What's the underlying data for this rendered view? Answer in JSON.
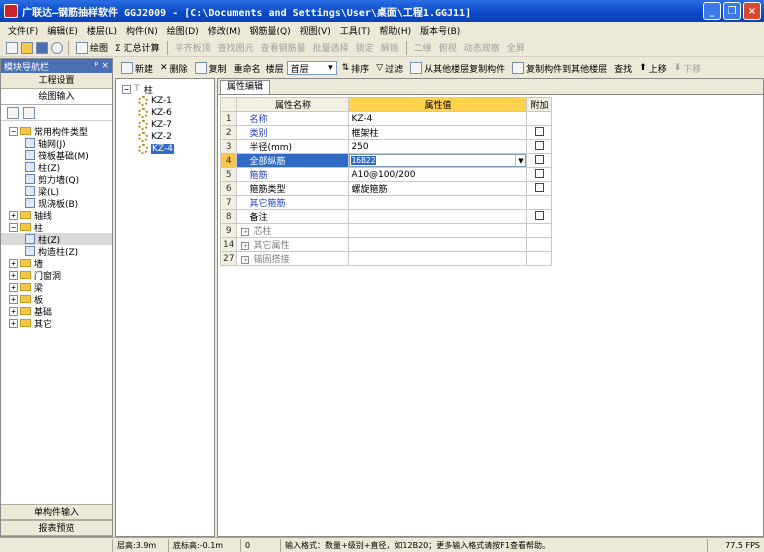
{
  "window": {
    "title": "广联达—钢筋抽样软件 GGJ2009 - [C:\\Documents and Settings\\User\\桌面\\工程1.GGJ11]",
    "buttons": [
      "_",
      "❐",
      "×"
    ]
  },
  "menu": [
    "文件(F)",
    "编辑(E)",
    "楼层(L)",
    "构件(N)",
    "绘图(D)",
    "修改(M)",
    "钢筋量(Q)",
    "视图(V)",
    "工具(T)",
    "帮助(H)",
    "版本号(B)"
  ],
  "toolbar": {
    "draw": "绘图",
    "sum": "Σ 汇总计算",
    "flat_top": "平齐板顶",
    "find_element": "查找图元",
    "view_rebar": "查看钢筋量",
    "batch_select": "批量选择",
    "lock": "锁定",
    "unlock": "解锁",
    "two_d": "二维",
    "view_angle": "俯视",
    "dynamic_view": "动态观察",
    "fullscreen": "全屏"
  },
  "left_panel": {
    "header": "模块导航栏",
    "pin": "ᵖ ×",
    "project_settings": "工程设置",
    "drawing_input": "绘图输入",
    "tree": {
      "common_types": "常用构件类型",
      "items": [
        "轴网(J)",
        "筏板基础(M)",
        "柱(Z)",
        "剪力墙(Q)",
        "梁(L)",
        "现浇板(B)"
      ],
      "axis": "轴线",
      "column": "柱",
      "column_children": [
        "柱(Z)",
        "构造柱(Z)"
      ],
      "wall": "墙",
      "door_window": "门窗洞",
      "beam": "梁",
      "slab": "板",
      "foundation": "基础",
      "other": "其它"
    },
    "single_input": "单构件输入",
    "report_preview": "报表预览"
  },
  "toolbar2": {
    "new": "新建",
    "delete": "删除",
    "copy": "复制",
    "rename": "重命名",
    "floor_label": "楼层",
    "floor_value": "首层",
    "sort": "排序",
    "filter": "过滤",
    "copy_from_other": "从其他楼层复制构件",
    "copy_to_other": "复制构件到其他楼层",
    "find": "查找",
    "move_up": "上移",
    "move_down": "下移"
  },
  "component_tree": {
    "root": "柱",
    "items": [
      "KZ-1",
      "KZ-6",
      "KZ-7",
      "KZ-2",
      "KZ-4"
    ],
    "selected_index": 4
  },
  "property_editor": {
    "tab": "属性编辑",
    "headers": {
      "name": "属性名称",
      "value": "属性值",
      "add": "附加"
    },
    "rows": [
      {
        "num": "1",
        "name": "名称",
        "value": "KZ-4",
        "blue": true,
        "checkbox": false
      },
      {
        "num": "2",
        "name": "类别",
        "value": "框架柱",
        "blue": true,
        "checkbox": true
      },
      {
        "num": "3",
        "name": "半径(mm)",
        "value": "250",
        "blue": false,
        "checkbox": true
      },
      {
        "num": "4",
        "name": "全部纵筋",
        "value": "16B22",
        "blue": false,
        "checkbox": true,
        "active": true
      },
      {
        "num": "5",
        "name": "箍筋",
        "value": "A10@100/200",
        "blue": true,
        "checkbox": true
      },
      {
        "num": "6",
        "name": "箍筋类型",
        "value": "螺旋箍筋",
        "blue": false,
        "checkbox": true
      },
      {
        "num": "7",
        "name": "其它箍筋",
        "value": "",
        "blue": true,
        "checkbox": false
      },
      {
        "num": "8",
        "name": "备注",
        "value": "",
        "blue": false,
        "checkbox": true
      }
    ],
    "groups": [
      {
        "num": "9",
        "name": "芯柱"
      },
      {
        "num": "14",
        "name": "其它属性"
      },
      {
        "num": "27",
        "name": "锚固搭接"
      }
    ]
  },
  "status": {
    "floor_height": "层高:3.9m",
    "bottom_elev": "底标高:-0.1m",
    "zero": "0",
    "hint": "输入格式：数量+级别+直径，如12B20；更多输入格式请按F1查看帮助。",
    "fps": "77.5 FPS"
  }
}
